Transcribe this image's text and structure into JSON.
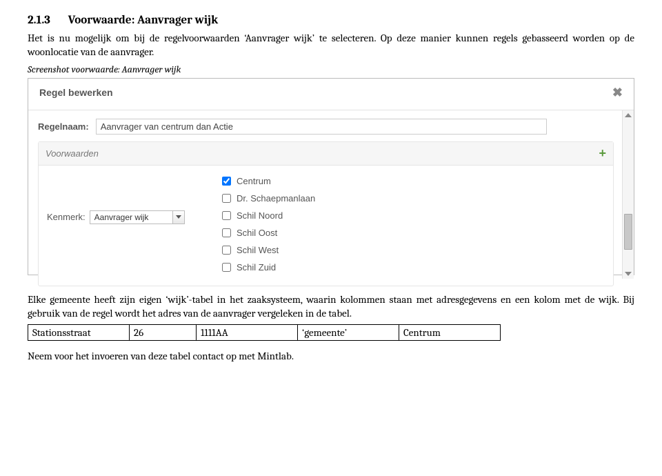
{
  "heading": {
    "number": "2.1.3",
    "text": "Voorwaarde: Aanvrager wijk"
  },
  "para1": "Het is nu mogelijk om bij de regelvoorwaarden ‘Aanvrager wijk’ te selecteren. Op deze manier kunnen regels gebasseerd worden op de woonlocatie van de aanvrager.",
  "caption": "Screenshot voorwaarde: Aanvrager wijk",
  "screenshot": {
    "title": "Regel bewerken",
    "regelnaam_label": "Regelnaam:",
    "regelnaam_value": "Aanvrager van centrum dan Actie",
    "voorwaarden_label": "Voorwaarden",
    "kenmerk_label": "Kenmerk:",
    "kenmerk_value": "Aanvrager wijk",
    "options": [
      {
        "label": "Centrum",
        "checked": true
      },
      {
        "label": "Dr. Schaepmanlaan",
        "checked": false
      },
      {
        "label": "Schil Noord",
        "checked": false
      },
      {
        "label": "Schil Oost",
        "checked": false
      },
      {
        "label": "Schil West",
        "checked": false
      },
      {
        "label": "Schil Zuid",
        "checked": false
      }
    ]
  },
  "para2": "Elke gemeente heeft zijn eigen ‘wijk’-tabel in het zaaksysteem, waarin kolommen staan met adresgegevens en een kolom met de wijk. Bij gebruik van de regel wordt het adres van de aanvrager vergeleken in de tabel.",
  "table": {
    "cells": [
      "Stationsstraat",
      "26",
      "1111AA",
      "‘gemeente’",
      "Centrum"
    ]
  },
  "para3": "Neem voor het invoeren van deze tabel contact op met Mintlab."
}
